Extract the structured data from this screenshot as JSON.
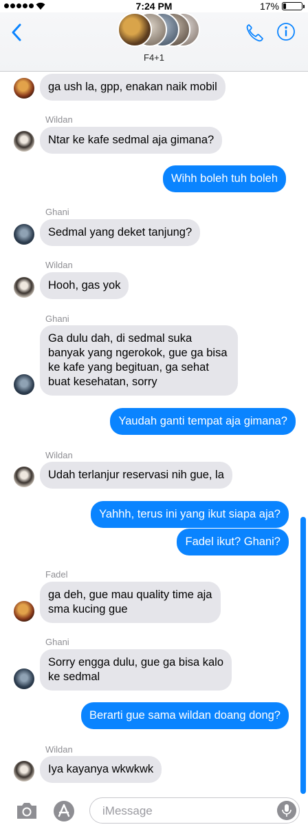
{
  "status": {
    "time": "7:24 PM",
    "battery": "17%"
  },
  "header": {
    "group_name": "F4+1"
  },
  "messages": [
    {
      "side": "in",
      "sender": "",
      "avatar": "fadel",
      "text_lines": [
        "ga ush la, gpp, enakan naik mobil"
      ]
    },
    {
      "side": "in",
      "sender": "Wildan",
      "avatar": "wildan",
      "text_lines": [
        "Ntar ke kafe sedmal aja gimana?"
      ]
    },
    {
      "side": "out",
      "text_lines": [
        "Wihh boleh tuh boleh"
      ]
    },
    {
      "side": "in",
      "sender": "Ghani",
      "avatar": "ghani",
      "text_lines": [
        "Sedmal yang deket tanjung?"
      ]
    },
    {
      "side": "in",
      "sender": "Wildan",
      "avatar": "wildan",
      "text_lines": [
        "Hooh, gas yok"
      ]
    },
    {
      "side": "in",
      "sender": "Ghani",
      "avatar": "ghani",
      "text_lines": [
        "Ga dulu dah, di sedmal suka",
        "banyak yang ngerokok, gue ga bisa",
        "ke kafe yang begituan, ga sehat",
        "buat kesehatan, sorry"
      ]
    },
    {
      "side": "out",
      "text_lines": [
        "Yaudah ganti tempat aja gimana?"
      ]
    },
    {
      "side": "in",
      "sender": "Wildan",
      "avatar": "wildan",
      "text_lines": [
        "Udah terlanjur reservasi nih gue, la"
      ]
    },
    {
      "side": "out",
      "text_lines": [
        "Yahhh, terus ini yang ikut siapa aja?"
      ]
    },
    {
      "side": "out",
      "text_lines": [
        "Fadel ikut? Ghani?"
      ]
    },
    {
      "side": "in",
      "sender": "Fadel",
      "avatar": "fadel",
      "text_lines": [
        "ga deh, gue mau quality time aja",
        "sma kucing gue"
      ]
    },
    {
      "side": "in",
      "sender": "Ghani",
      "avatar": "ghani",
      "text_lines": [
        "Sorry engga dulu, gue ga bisa kalo",
        "ke sedmal"
      ]
    },
    {
      "side": "out",
      "text_lines": [
        "Berarti gue sama wildan doang dong?"
      ]
    },
    {
      "side": "in",
      "sender": "Wildan",
      "avatar": "wildan",
      "text_lines": [
        "Iya kayanya wkwkwk"
      ]
    }
  ],
  "input": {
    "placeholder": "iMessage"
  },
  "colors": {
    "accent": "#0a84ff",
    "incoming_bubble": "#e5e5ea",
    "nav_background": "#f4f5f7"
  },
  "icons": [
    "back-chevron-icon",
    "phone-icon",
    "info-icon",
    "camera-icon",
    "app-store-icon",
    "microphone-icon"
  ]
}
